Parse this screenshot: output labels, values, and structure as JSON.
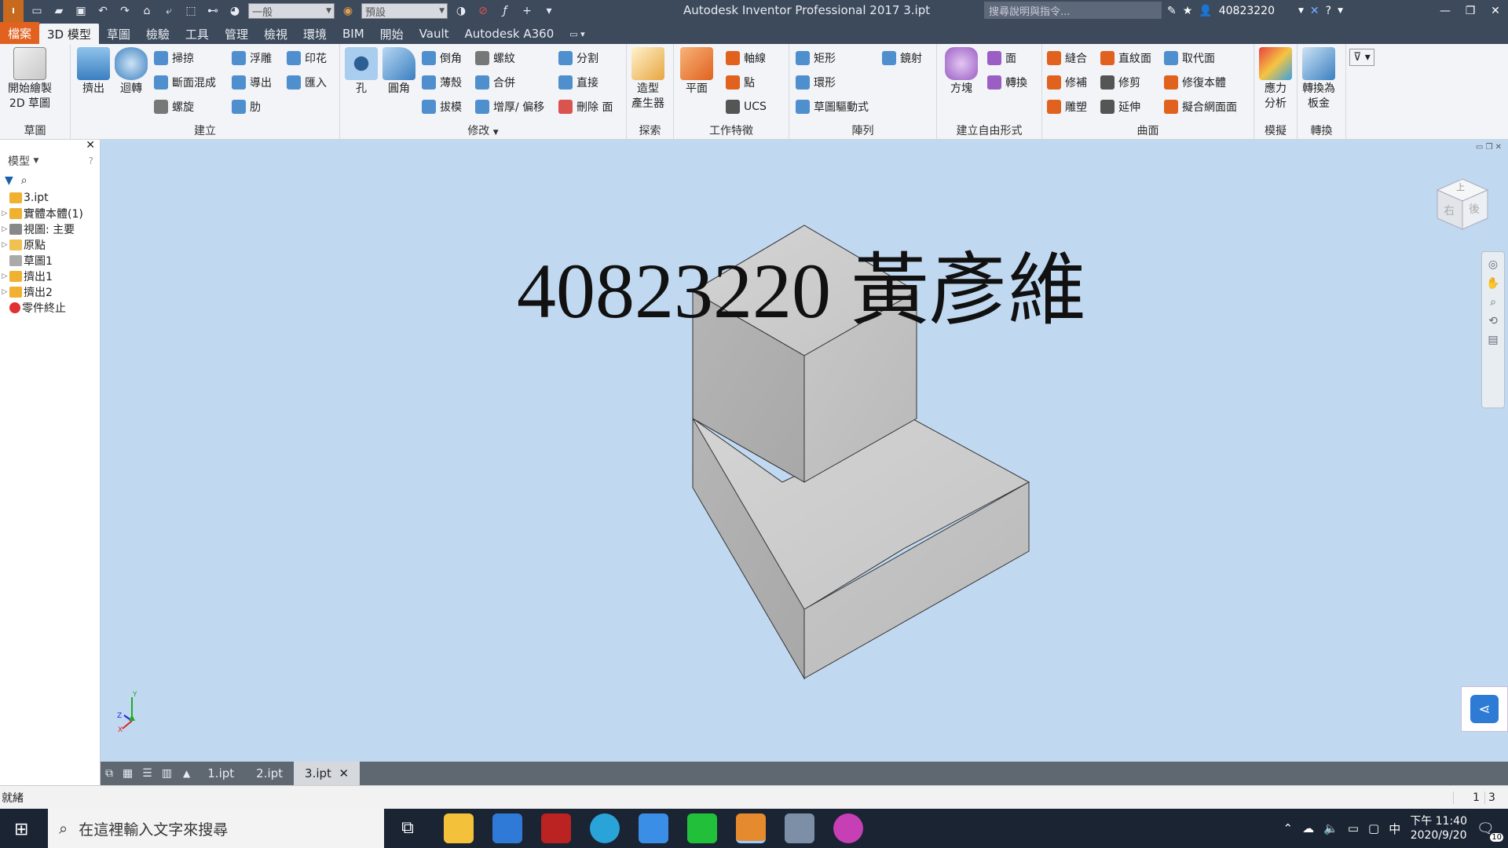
{
  "colors": {
    "accent": "#e0621e",
    "titlebar": "#3d4a5c",
    "viewport": "#c0d9f1",
    "part": "#bdbdbd"
  },
  "titlebar": {
    "title": "Autodesk Inventor Professional 2017    3.ipt",
    "dropdown_material": "一般",
    "dropdown_appearance": "預設",
    "search_placeholder": "搜尋說明與指令...",
    "user": "40823220",
    "icons": [
      "pro-logo-icon",
      "new-icon",
      "open-icon",
      "save-icon",
      "undo-icon",
      "redo-icon",
      "home-icon",
      "return-icon",
      "select-icon",
      "measure-icon",
      "color-icon",
      "appearance-icon",
      "clear-override-icon",
      "fx-icon",
      "plus-icon",
      "customize-icon"
    ]
  },
  "tabs": [
    "檔案",
    "3D 模型",
    "草圖",
    "檢驗",
    "工具",
    "管理",
    "檢視",
    "環境",
    "BIM",
    "開始",
    "Vault",
    "Autodesk A360"
  ],
  "ribbon": {
    "sketch": {
      "title": "草圖",
      "start_sketch": "開始繪製\n2D 草圖"
    },
    "create": {
      "title": "建立",
      "extrude": "擠出",
      "revolve": "迴轉",
      "sweep": "掃掠",
      "loft": "斷面混成",
      "coil": "螺旋",
      "emboss": "浮雕",
      "derive": "導出",
      "rib": "肋",
      "decal": "印花",
      "import": "匯入"
    },
    "modify": {
      "title": "修改",
      "hole": "孔",
      "fillet": "圓角",
      "chamfer": "倒角",
      "shell": "薄殼",
      "draft": "拔模",
      "thread": "螺紋",
      "combine": "合併",
      "thicken": "增厚/ 偏移",
      "split": "分割",
      "direct": "直接",
      "delete_face": "刪除 面"
    },
    "explore": {
      "title": "探索",
      "shape_generator": "造型\n產生器"
    },
    "work": {
      "title": "工作特徵",
      "plane": "平面",
      "axis": "軸線",
      "point": "點",
      "ucs": "UCS"
    },
    "pattern": {
      "title": "陣列",
      "rect": "矩形",
      "circ": "環形",
      "sketch_driven": "草圖驅動式",
      "mirror": "鏡射"
    },
    "freeform": {
      "title": "建立自由形式",
      "box": "方塊",
      "face": "面",
      "convert": "轉換"
    },
    "surface": {
      "title": "曲面",
      "stitch": "縫合",
      "patch": "修補",
      "sculpt": "雕塑",
      "ruled": "直紋面",
      "trim": "修剪",
      "extend": "延伸",
      "replace_face": "取代面",
      "repair": "修復本體",
      "fit_mesh": "擬合網面面"
    },
    "simulation": {
      "title": "模擬",
      "stress": "應力\n分析"
    },
    "convert": {
      "title": "轉換",
      "sheet_metal": "轉換為\n板金"
    }
  },
  "browser": {
    "header": "模型",
    "nodes": [
      {
        "label": "3.ipt",
        "expand": "",
        "icon": "part-icon",
        "indent": 0
      },
      {
        "label": "實體本體(1)",
        "expand": "▷",
        "icon": "solid-bodies-icon",
        "indent": 0
      },
      {
        "label": "視圖: 主要",
        "expand": "▷",
        "icon": "view-rep-icon",
        "indent": 0
      },
      {
        "label": "原點",
        "expand": "▷",
        "icon": "origin-folder-icon",
        "indent": 0
      },
      {
        "label": "草圖1",
        "expand": "",
        "icon": "sketch-icon",
        "indent": 0
      },
      {
        "label": "擠出1",
        "expand": "▷",
        "icon": "extrude-icon",
        "indent": 0
      },
      {
        "label": "擠出2",
        "expand": "▷",
        "icon": "extrude-icon",
        "indent": 0
      },
      {
        "label": "零件終止",
        "expand": "",
        "icon": "end-of-part-icon",
        "indent": 0
      }
    ]
  },
  "viewport": {
    "overlay_text": "40823220 黃彥維",
    "viewcube_top": "上",
    "viewcube_front": "右",
    "viewcube_right": "後"
  },
  "doc_tabs": [
    "1.ipt",
    "2.ipt",
    "3.ipt"
  ],
  "status": {
    "text": "就緒",
    "count1": "1",
    "count2": "3"
  },
  "taskbar": {
    "search_placeholder": "在這裡輸入文字來搜尋",
    "time": "下午 11:40",
    "date": "2020/9/20",
    "ime": "中",
    "notif_count": "10"
  }
}
